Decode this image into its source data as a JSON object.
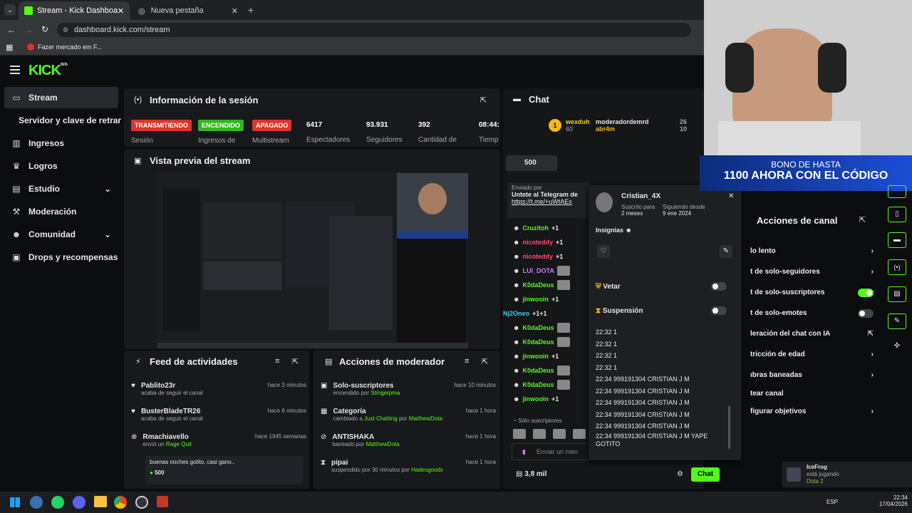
{
  "browser": {
    "tabs": [
      {
        "label": "Stream - Kick Dashboard"
      },
      {
        "label": "Nueva pestaña"
      }
    ],
    "url": "dashboard.kick.com/stream",
    "bookmark": "Fazer mercado em F..."
  },
  "brand": {
    "logo": "KICK",
    "beta": "BETA",
    "accent": "#53fc18"
  },
  "nav": {
    "items": [
      {
        "label": "Stream",
        "icon": "stream-icon"
      },
      {
        "label": "Servidor y clave de retransn",
        "icon": ""
      },
      {
        "label": "Ingresos",
        "icon": "ingresos-icon"
      },
      {
        "label": "Logros",
        "icon": "trophy-icon"
      },
      {
        "label": "Estudio",
        "icon": "studio-icon"
      },
      {
        "label": "Moderación",
        "icon": "hammer-icon"
      },
      {
        "label": "Comunidad",
        "icon": "community-icon"
      },
      {
        "label": "Drops y recompensas",
        "icon": "gift-icon"
      }
    ]
  },
  "session": {
    "title": "Información de la sesión",
    "badges": [
      {
        "text": "TRANSMITIENDO",
        "label": "Sesión",
        "color": "#e0342c"
      },
      {
        "text": "ENCENDIDO",
        "label": "Ingresos de",
        "color": "#35b51e"
      },
      {
        "text": "APAGADO",
        "label": "Multistream",
        "color": "#e0342c"
      }
    ],
    "stats": [
      {
        "value": "6417",
        "label": "Espectadores"
      },
      {
        "value": "93.931",
        "label": "Seguidores"
      },
      {
        "value": "392",
        "label": "Cantidad de"
      },
      {
        "value": "08:44:",
        "label": "Tiemp"
      }
    ]
  },
  "preview": {
    "title": "Vista previa del stream"
  },
  "feed": {
    "title": "Feed de actividades",
    "items": [
      {
        "user": "Pablito23r",
        "action": "acaba de seguir el canal",
        "time": "hace 3 minutos"
      },
      {
        "user": "BusterBladeTR26",
        "action": "acaba de seguir el canal",
        "time": "hace 6 minutos"
      },
      {
        "user": "Rmachiavello",
        "action": "envió un",
        "extra": "Rage Quit",
        "time": "hace 1945 semanas",
        "msg": "buenas noches gotito, casi gano..",
        "amount": "500"
      }
    ]
  },
  "modactions": {
    "title": "Acciones de moderador",
    "items": [
      {
        "title": "Solo-suscriptores",
        "desc": "encendido por",
        "by": "Stingerpma",
        "time": "hace 10 minutos"
      },
      {
        "title": "Categoría",
        "desc": "cambiado a",
        "target": "Just Chatting",
        "mid": "por",
        "by": "MatthewDota",
        "time": "hace 1 hora"
      },
      {
        "title": "ANTISHAKA",
        "desc": "baneado por",
        "by": "MatthewDota",
        "time": "hace 1 hora"
      },
      {
        "title": "pipai",
        "desc": "suspendido por 30 minutos por",
        "by": "Hadesgoodx",
        "time": "hace 1 hora"
      }
    ]
  },
  "chat": {
    "title": "Chat",
    "top": [
      {
        "rank": "1",
        "name": "wexduh",
        "count": "60"
      },
      {
        "name": "moderadordemrd",
        "count": "26"
      },
      {
        "name": "abr4m",
        "count": "10"
      }
    ],
    "kicks": "500",
    "pinned": {
      "by": "Enviado por",
      "text": "Untete al Telegram de",
      "link": "https://t.me/+uWtAEx"
    },
    "lines": [
      {
        "user": "Cruzitoh",
        "text": "+1",
        "color": "#53fc18"
      },
      {
        "user": "nicoteddy",
        "text": "+1",
        "color": "#ff4d6d"
      },
      {
        "user": "nicoteddy",
        "text": "+1",
        "color": "#ff4d6d"
      },
      {
        "user": "LUI_DOTA",
        "text": "",
        "color": "#c77dff"
      },
      {
        "user": "K0daDeus",
        "text": "",
        "color": "#53fc18"
      },
      {
        "user": "jinwooin",
        "text": "+1",
        "color": "#53fc18"
      },
      {
        "user": "Nj2Oneo",
        "text": "+1+1",
        "color": "#4cc9f0"
      },
      {
        "user": "K0daDeus",
        "text": "",
        "color": "#53fc18"
      },
      {
        "user": "K0daDeus",
        "text": "",
        "color": "#53fc18"
      },
      {
        "user": "jinwooin",
        "text": "+1",
        "color": "#53fc18"
      },
      {
        "user": "K0daDeus",
        "text": "",
        "color": "#53fc18"
      },
      {
        "user": "K0daDeus",
        "text": "",
        "color": "#53fc18"
      },
      {
        "user": "jinwooin",
        "text": "+1",
        "color": "#53fc18"
      }
    ],
    "mode": "Sólo suscriptores",
    "placeholder": "Enviar un men",
    "viewers": "3,8 mil",
    "send": "Chat"
  },
  "usercard": {
    "name": "Cristian_4X",
    "sub_label": "Suscrito para",
    "sub_value": "2 meses",
    "follow_label": "Siguiendo desde",
    "follow_value": "9 ene 2024",
    "insignias": "Insignias",
    "vetar": "Vetar",
    "suspension": "Suspensión",
    "history": [
      "22:32 1",
      "22:32 1",
      "22:32 1",
      "22:32 1",
      "22:34 999191304 CRISTIAN J M",
      "22:34 999191304 CRISTIAN J M",
      "22:34 999191304 CRISTIAN J M",
      "22:34 999191304 CRISTIAN J M",
      "22:34 999191304 CRISTIAN J M",
      "22:34 999191304 CRISTIAN J M YAPE GOTITO"
    ]
  },
  "channelactions": {
    "title": "Acciones de canal",
    "items": [
      {
        "label": "lo lento",
        "control": "chevron"
      },
      {
        "label": "t de solo-seguidores",
        "control": "chevron"
      },
      {
        "label": "t de solo-suscriptores",
        "control": "toggle-on"
      },
      {
        "label": "t de solo-emotes",
        "control": "toggle-off"
      },
      {
        "label": "leración del chat con IA",
        "control": "link"
      },
      {
        "label": "tricción de edad",
        "control": "chevron"
      },
      {
        "label": "ıbras baneadas",
        "control": "chevron"
      },
      {
        "label": "tear canal",
        "control": "none"
      },
      {
        "label": "figurar objetivos",
        "control": "chevron"
      }
    ]
  },
  "overlay": {
    "line1": "BONO DE HASTA",
    "line2": "1100 AHORA CON EL CÓDIGO"
  },
  "notification": {
    "name": "IceFrog",
    "status": "está jugando",
    "game": "Dota 2"
  },
  "taskbar": {
    "lang": "ESP",
    "time": "22:34",
    "date": "17/04/2026"
  }
}
